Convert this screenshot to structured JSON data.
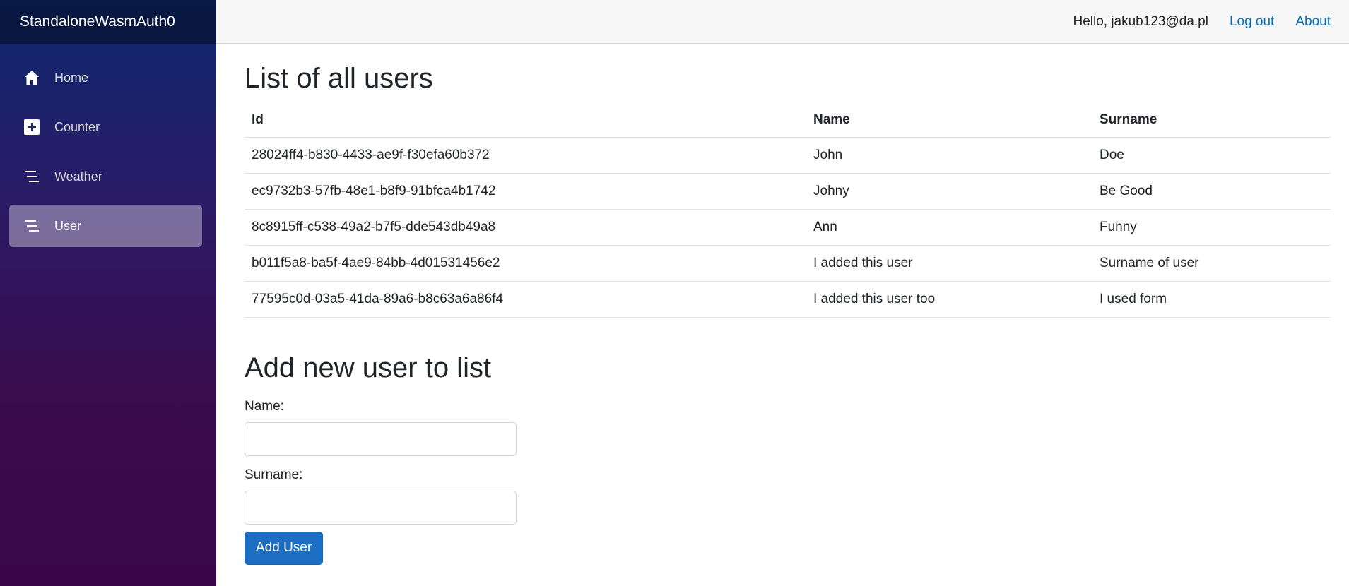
{
  "app": {
    "brand": "StandaloneWasmAuth0"
  },
  "topbar": {
    "greeting": "Hello, jakub123@da.pl",
    "logout_label": "Log out",
    "about_label": "About"
  },
  "sidebar": {
    "items": [
      {
        "label": "Home",
        "icon": "home-icon"
      },
      {
        "label": "Counter",
        "icon": "plus-square-icon"
      },
      {
        "label": "Weather",
        "icon": "list-icon"
      },
      {
        "label": "User",
        "icon": "list-icon",
        "active": true
      }
    ]
  },
  "main": {
    "list_title": "List of all users",
    "table": {
      "headers": [
        "Id",
        "Name",
        "Surname"
      ],
      "rows": [
        [
          "28024ff4-b830-4433-ae9f-f30efa60b372",
          "John",
          "Doe"
        ],
        [
          "ec9732b3-57fb-48e1-b8f9-91bfca4b1742",
          "Johny",
          "Be Good"
        ],
        [
          "8c8915ff-c538-49a2-b7f5-dde543db49a8",
          "Ann",
          "Funny"
        ],
        [
          "b011f5a8-ba5f-4ae9-84bb-4d01531456e2",
          "I added this user",
          "Surname of user"
        ],
        [
          "77595c0d-03a5-41da-89a6-b8c63a6a86f4",
          "I added this user too",
          "I used form"
        ]
      ]
    },
    "form": {
      "title": "Add new user to list",
      "name_label": "Name:",
      "name_value": "",
      "surname_label": "Surname:",
      "surname_value": "",
      "submit_label": "Add User"
    }
  },
  "colors": {
    "accent": "#1b6ec2",
    "link": "#0071c1",
    "sidebar_top": "#0d2a6e",
    "sidebar_bottom": "#3a0647"
  }
}
